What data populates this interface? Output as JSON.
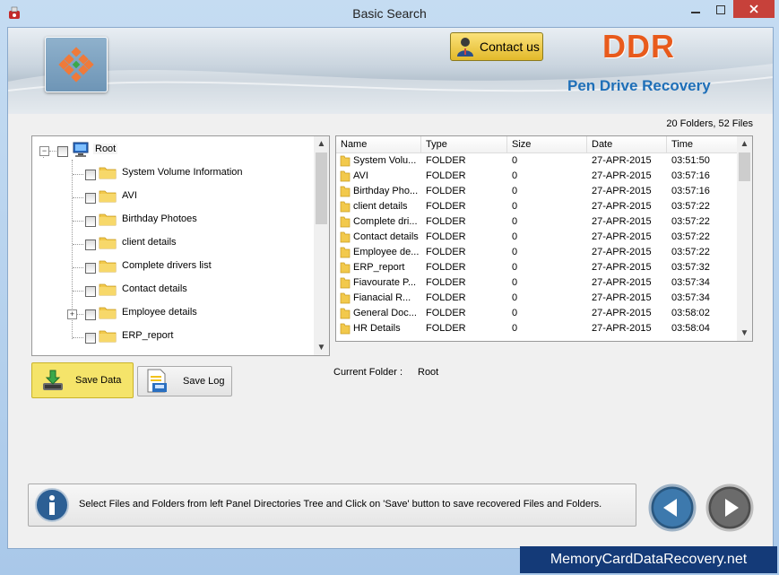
{
  "window": {
    "title": "Basic Search"
  },
  "banner": {
    "contact_label": "Contact us",
    "brand": "DDR",
    "product": "Pen Drive Recovery"
  },
  "summary": {
    "counts": "20 Folders, 52 Files"
  },
  "tree": {
    "root": "Root",
    "items": [
      {
        "label": "System Volume Information",
        "expandable": false
      },
      {
        "label": "AVI",
        "expandable": false
      },
      {
        "label": "Birthday Photoes",
        "expandable": false
      },
      {
        "label": "client details",
        "expandable": false
      },
      {
        "label": "Complete drivers list",
        "expandable": false
      },
      {
        "label": "Contact details",
        "expandable": false
      },
      {
        "label": "Employee details",
        "expandable": true
      },
      {
        "label": "ERP_report",
        "expandable": false
      }
    ]
  },
  "list": {
    "columns": [
      "Name",
      "Type",
      "Size",
      "Date",
      "Time"
    ],
    "rows": [
      [
        "System Volu...",
        "FOLDER",
        "0",
        "27-APR-2015",
        "03:51:50"
      ],
      [
        "AVI",
        "FOLDER",
        "0",
        "27-APR-2015",
        "03:57:16"
      ],
      [
        "Birthday Pho...",
        "FOLDER",
        "0",
        "27-APR-2015",
        "03:57:16"
      ],
      [
        "client details",
        "FOLDER",
        "0",
        "27-APR-2015",
        "03:57:22"
      ],
      [
        "Complete dri...",
        "FOLDER",
        "0",
        "27-APR-2015",
        "03:57:22"
      ],
      [
        "Contact details",
        "FOLDER",
        "0",
        "27-APR-2015",
        "03:57:22"
      ],
      [
        "Employee de...",
        "FOLDER",
        "0",
        "27-APR-2015",
        "03:57:22"
      ],
      [
        "ERP_report",
        "FOLDER",
        "0",
        "27-APR-2015",
        "03:57:32"
      ],
      [
        "Fiavourate P...",
        "FOLDER",
        "0",
        "27-APR-2015",
        "03:57:34"
      ],
      [
        "Fianacial R...",
        "FOLDER",
        "0",
        "27-APR-2015",
        "03:57:34"
      ],
      [
        "General Doc...",
        "FOLDER",
        "0",
        "27-APR-2015",
        "03:58:02"
      ],
      [
        "HR Details",
        "FOLDER",
        "0",
        "27-APR-2015",
        "03:58:04"
      ]
    ]
  },
  "actions": {
    "save_data": "Save Data",
    "save_log": "Save Log"
  },
  "current_folder": {
    "label": "Current Folder :",
    "value": "Root"
  },
  "info": {
    "message": "Select Files and Folders from left Panel Directories Tree and Click on 'Save' button to save recovered Files and Folders."
  },
  "watermark": "MemoryCardDataRecovery.net",
  "colors": {
    "brand": "#e85a1c",
    "product": "#1e6fb8",
    "save_highlight": "#f5e46a",
    "watermark_bg": "#143a78"
  },
  "icons": [
    "app-icon",
    "logo-icon",
    "contact-person-icon",
    "computer-icon",
    "folder-icon",
    "save-download-icon",
    "save-log-icon",
    "info-icon",
    "back-arrow-icon",
    "next-arrow-icon"
  ]
}
